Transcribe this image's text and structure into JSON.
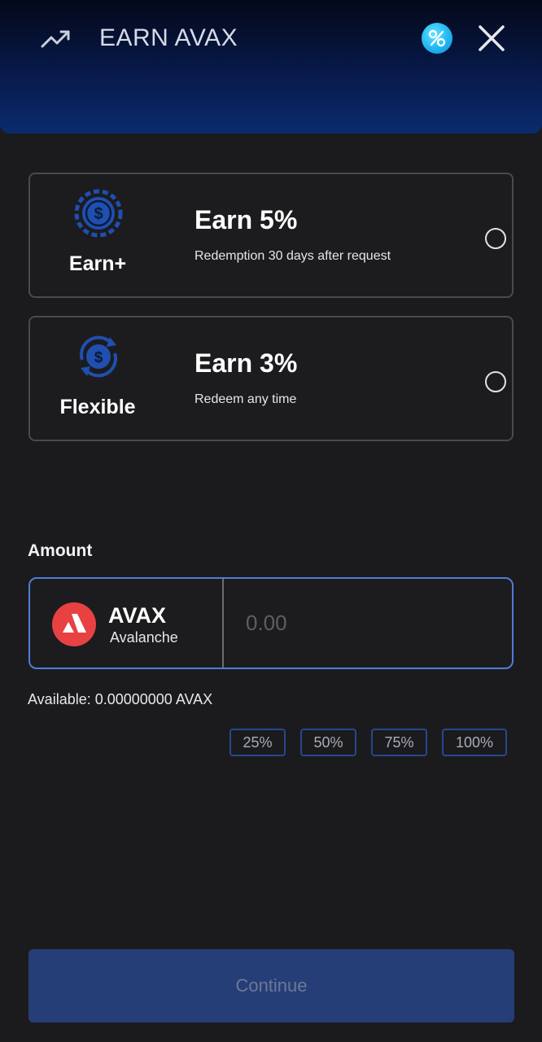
{
  "header": {
    "title": "EARN AVAX",
    "left_icon": "trending-up-icon",
    "promo_icon": "percent-badge-icon",
    "close_icon": "close-icon"
  },
  "options": [
    {
      "plan_name": "Earn+",
      "rate": "Earn 5%",
      "description": "Redemption 30 days after request",
      "icon": "dollar-coin-icon",
      "selected": false
    },
    {
      "plan_name": "Flexible",
      "rate": "Earn 3%",
      "description": "Redeem any time",
      "icon": "dollar-refresh-icon",
      "selected": false
    }
  ],
  "amount": {
    "label": "Amount",
    "token_symbol": "AVAX",
    "token_name": "Avalanche",
    "placeholder": "0.00",
    "value": "",
    "available": "Available: 0.00000000 AVAX"
  },
  "percent_buttons": [
    "25%",
    "50%",
    "75%",
    "100%"
  ],
  "continue_label": "Continue",
  "colors": {
    "background": "#1b1b1d",
    "accent_border": "#4f7cd6",
    "avalanche_red": "#e84142",
    "continue_bg": "#263e78"
  }
}
